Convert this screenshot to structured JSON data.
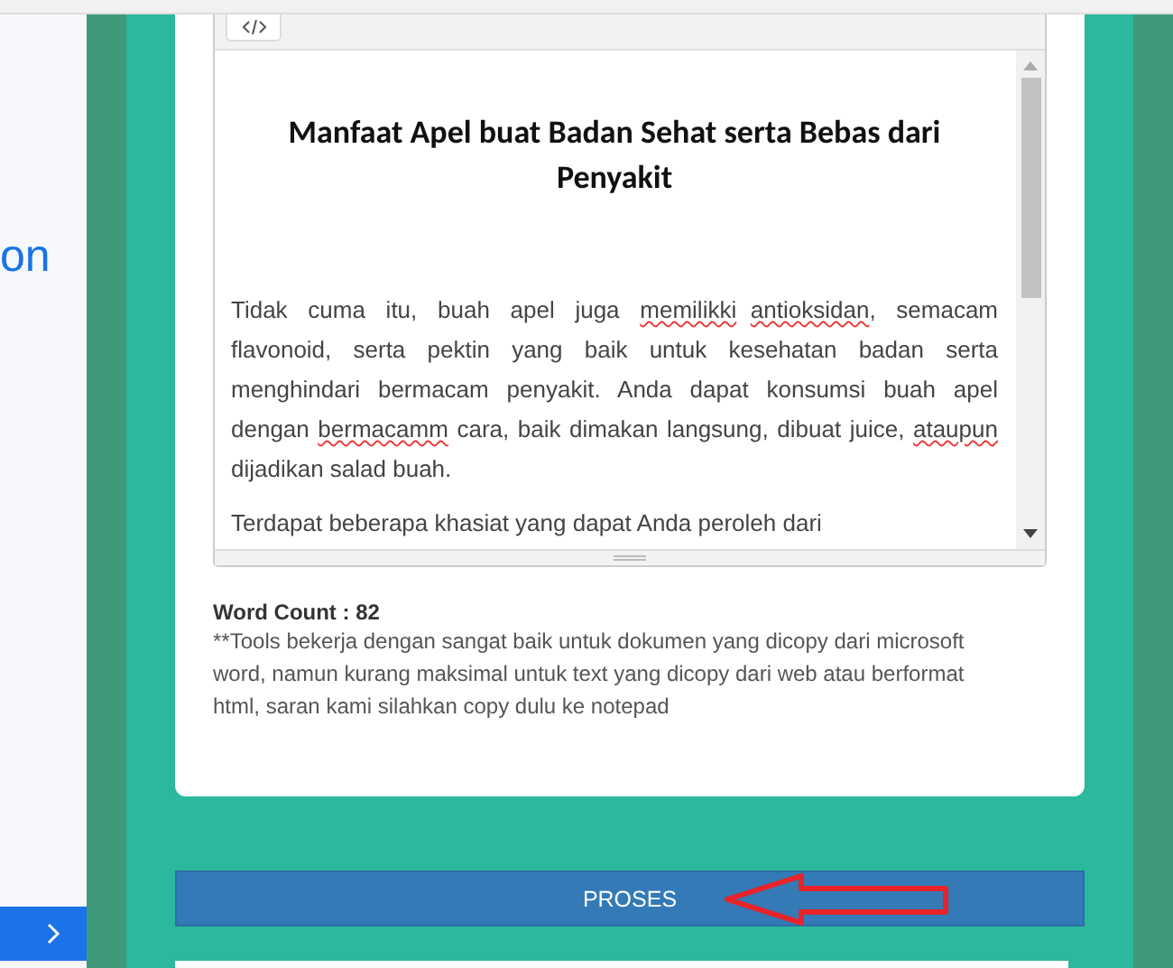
{
  "side_ad": {
    "text": "on"
  },
  "editor": {
    "heading": "Manfaat Apel buat Badan Sehat serta Bebas dari Penyakit",
    "paragraphs": [
      [
        {
          "text": "Tidak cuma itu,  buah apel juga ",
          "misspelled": false
        },
        {
          "text": "memilikki",
          "misspelled": true
        },
        {
          "text": "antioksidan",
          "misspelled": true
        },
        {
          "text": ", semacam flavonoid, serta pektin yang baik untuk kesehatan badan serta menghindari bermacam  penyakit. Anda dapat konsumsi buah apel dengan ",
          "misspelled": false
        },
        {
          "text": "bermacamm",
          "misspelled": true
        },
        {
          "text": " cara, baik dimakan langsung, dibuat juice, ",
          "misspelled": false
        },
        {
          "text": "ataupun",
          "misspelled": true
        },
        {
          "text": " dijadikan salad buah.",
          "misspelled": false
        }
      ],
      [
        {
          "text": "Terdapat beberapa  khasiat yang  dapat Anda peroleh dari",
          "misspelled": false
        }
      ]
    ]
  },
  "word_count": "Word Count : 82",
  "note": "**Tools bekerja dengan sangat baik untuk dokumen yang dicopy dari microsoft word, namun kurang maksimal untuk text yang dicopy dari web atau berformat html, saran kami silahkan copy dulu ke notepad",
  "process_button": "PROSES"
}
